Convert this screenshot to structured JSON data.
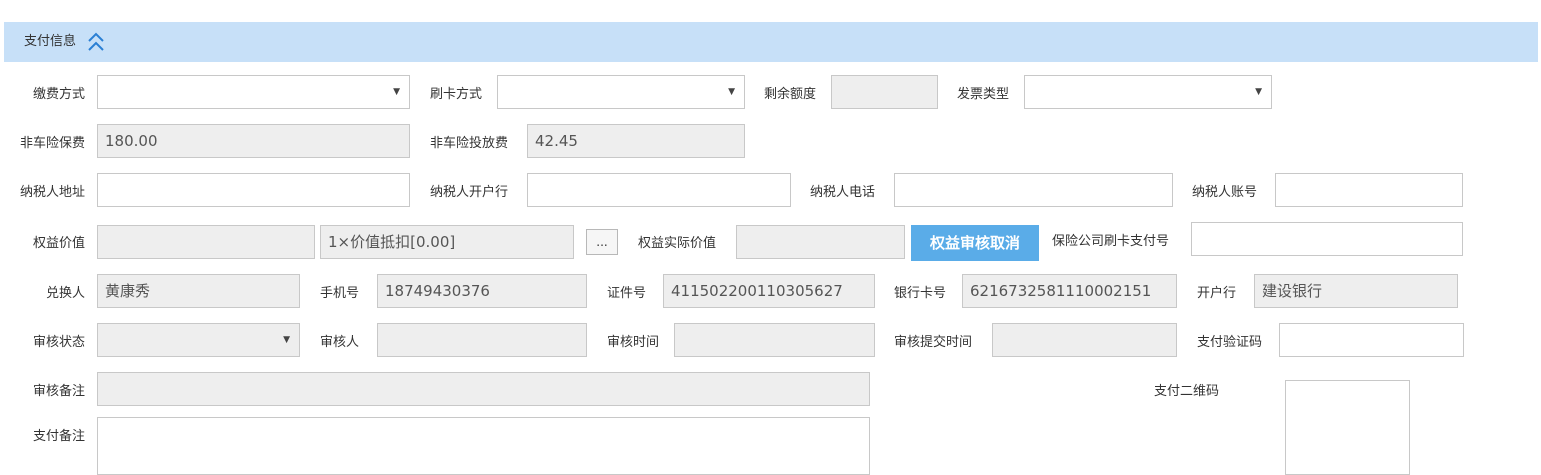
{
  "section": {
    "title": "支付信息",
    "collapse_icon": "double-chevron-up-icon"
  },
  "row1": {
    "payment_method_label": "缴费方式",
    "payment_method_value": "",
    "card_method_label": "刷卡方式",
    "card_method_value": "",
    "remaining_quota_label": "剩余额度",
    "remaining_quota_value": "",
    "invoice_type_label": "发票类型",
    "invoice_type_value": ""
  },
  "row2": {
    "noncar_premium_label": "非车险保费",
    "noncar_premium_value": "180.00",
    "noncar_delivery_label": "非车险投放费",
    "noncar_delivery_value": "42.45"
  },
  "row3": {
    "taxpayer_address_label": "纳税人地址",
    "taxpayer_address_value": "",
    "taxpayer_bank_label": "纳税人开户行",
    "taxpayer_bank_value": "",
    "taxpayer_phone_label": "纳税人电话",
    "taxpayer_phone_value": "",
    "taxpayer_account_label": "纳税人账号",
    "taxpayer_account_value": ""
  },
  "row4": {
    "equity_value_label": "权益价值",
    "equity_value_value": "",
    "equity_deduct_value": "1×价值抵扣[0.00]",
    "browse_button_label": "...",
    "equity_actual_label": "权益实际价值",
    "equity_actual_value": "",
    "cancel_audit_button_label": "权益审核取消",
    "insurer_card_pay_label": "保险公司刷卡支付号",
    "insurer_card_pay_value": ""
  },
  "row5": {
    "redeemer_label": "兑换人",
    "redeemer_value": "黄康秀",
    "mobile_label": "手机号",
    "mobile_value": "18749430376",
    "id_number_label": "证件号",
    "id_number_value": "411502200110305627",
    "bank_card_label": "银行卡号",
    "bank_card_value": "6216732581110002151",
    "bank_label": "开户行",
    "bank_value": "建设银行"
  },
  "row6": {
    "audit_status_label": "审核状态",
    "audit_status_value": "",
    "auditor_label": "审核人",
    "auditor_value": "",
    "audit_time_label": "审核时间",
    "audit_time_value": "",
    "audit_submit_time_label": "审核提交时间",
    "audit_submit_time_value": "",
    "pay_code_label": "支付验证码",
    "pay_code_value": ""
  },
  "row7": {
    "audit_remark_label": "审核备注",
    "audit_remark_value": "",
    "pay_qrcode_label": "支付二维码"
  },
  "row8": {
    "pay_remark_label": "支付备注",
    "pay_remark_value": ""
  },
  "icons": {
    "dropdown": "caret-down-icon"
  },
  "colors": {
    "header_bg": "#c7e0f8",
    "accent_button": "#5aace8",
    "readonly_bg": "#eeeeee",
    "chevron": "#2a7fd4"
  }
}
